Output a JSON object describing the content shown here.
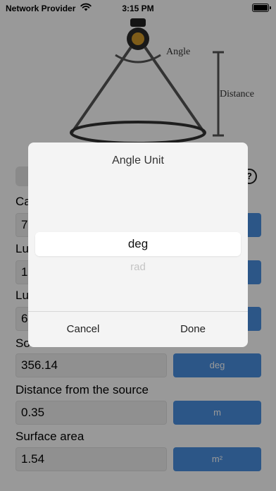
{
  "status_bar": {
    "carrier": "Network Provider",
    "time": "3:15 PM"
  },
  "diagram": {
    "angle_label": "Angle",
    "distance_label": "Distance"
  },
  "fields": [
    {
      "label": "Ca",
      "value": "7"
    },
    {
      "label": "Lu",
      "value": "1"
    },
    {
      "label": "Lu",
      "value": "6"
    },
    {
      "label": "So",
      "value": "356.14",
      "unit": "deg"
    },
    {
      "label": "Distance from the source",
      "value": "0.35",
      "unit": "m"
    },
    {
      "label": "Surface area",
      "value": "1.54",
      "unit": "m²"
    }
  ],
  "picker": {
    "title": "Angle Unit",
    "options": [
      "deg",
      "rad"
    ],
    "selected": "deg",
    "cancel_label": "Cancel",
    "done_label": "Done"
  },
  "colors": {
    "accent": "#4a90e2",
    "overlay": "rgba(0,0,0,0.40)",
    "dialog": "#f4f4f4"
  }
}
